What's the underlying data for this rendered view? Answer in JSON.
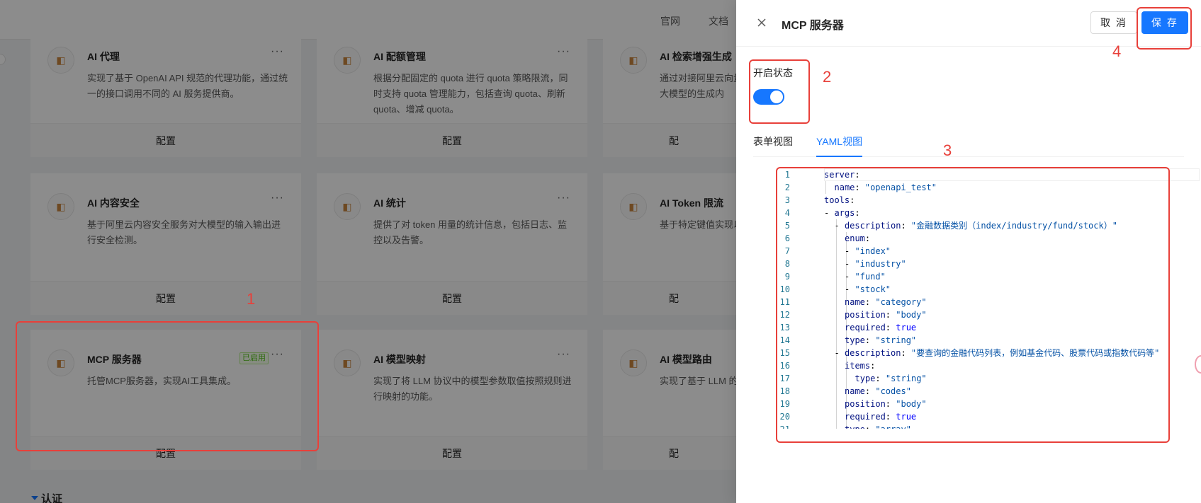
{
  "topbar": {
    "links": [
      "官网",
      "文档"
    ]
  },
  "cards": [
    {
      "title": "AI 代理",
      "desc": "实现了基于 OpenAI API 规范的代理功能，通过统一的接口调用不同的 AI 服务提供商。",
      "config": "配置",
      "more": "···"
    },
    {
      "title": "AI 配额管理",
      "desc": "根据分配固定的 quota 进行 quota 策略限流，同时支持 quota 管理能力，包括查询 quota、刷新 quota、增减 quota。",
      "config": "配置",
      "more": "···"
    },
    {
      "title": "AI 检索增强生成",
      "desc": "通过对接阿里云向量检索服务（DashVector）化大模型的生成内",
      "config": "配",
      "more": ""
    },
    {
      "title": "AI 内容安全",
      "desc": "基于阿里云内容安全服务对大模型的输入输出进行安全检测。",
      "config": "配置",
      "more": "···"
    },
    {
      "title": "AI 统计",
      "desc": "提供了对 token 用量的统计信息，包括日志、监控以及告警。",
      "config": "配置",
      "more": "···"
    },
    {
      "title": "AI Token 限流",
      "desc": "基于特定键值实现以是 URL 参数、H址等。",
      "config": "配",
      "more": ""
    },
    {
      "title": "MCP 服务器",
      "desc": "托管MCP服务器，实现AI工具集成。",
      "config": "配置",
      "more": "···",
      "badge": "已启用"
    },
    {
      "title": "AI 模型映射",
      "desc": "实现了将 LLM 协议中的模型参数取值按照规则进行映射的功能。",
      "config": "配置",
      "more": "···"
    },
    {
      "title": "AI 模型路由",
      "desc": "实现了基于 LLM 的功能",
      "config": "配",
      "more": ""
    }
  ],
  "section": {
    "title": "认证"
  },
  "drawer": {
    "title": "MCP 服务器",
    "cancel_label": "取 消",
    "save_label": "保 存",
    "status_label": "开启状态",
    "status_enabled": true,
    "tabs": [
      {
        "label": "表单视图",
        "active": false
      },
      {
        "label": "YAML视图",
        "active": true
      }
    ]
  },
  "yaml_lines": [
    {
      "n": "1",
      "indent": 0,
      "parts": [
        [
          "k",
          "server"
        ],
        [
          "p",
          ":"
        ]
      ]
    },
    {
      "n": "2",
      "indent": 1,
      "parts": [
        [
          "k",
          "name"
        ],
        [
          "p",
          ": "
        ],
        [
          "s",
          "\"openapi_test\""
        ]
      ]
    },
    {
      "n": "3",
      "indent": 0,
      "parts": [
        [
          "k",
          "tools"
        ],
        [
          "p",
          ":"
        ]
      ]
    },
    {
      "n": "4",
      "indent": 0,
      "parts": [
        [
          "p",
          "- "
        ],
        [
          "k",
          "args"
        ],
        [
          "p",
          ":"
        ]
      ]
    },
    {
      "n": "5",
      "indent": 1,
      "parts": [
        [
          "p",
          "- "
        ],
        [
          "k",
          "description"
        ],
        [
          "p",
          ": "
        ],
        [
          "s",
          "\"金融数据类别（index/industry/fund/stock）\""
        ]
      ]
    },
    {
      "n": "6",
      "indent": 2,
      "parts": [
        [
          "k",
          "enum"
        ],
        [
          "p",
          ":"
        ]
      ]
    },
    {
      "n": "7",
      "indent": 2,
      "parts": [
        [
          "p",
          "- "
        ],
        [
          "s",
          "\"index\""
        ]
      ]
    },
    {
      "n": "8",
      "indent": 2,
      "parts": [
        [
          "p",
          "- "
        ],
        [
          "s",
          "\"industry\""
        ]
      ]
    },
    {
      "n": "9",
      "indent": 2,
      "parts": [
        [
          "p",
          "- "
        ],
        [
          "s",
          "\"fund\""
        ]
      ]
    },
    {
      "n": "10",
      "indent": 2,
      "parts": [
        [
          "p",
          "- "
        ],
        [
          "s",
          "\"stock\""
        ]
      ]
    },
    {
      "n": "11",
      "indent": 2,
      "parts": [
        [
          "k",
          "name"
        ],
        [
          "p",
          ": "
        ],
        [
          "s",
          "\"category\""
        ]
      ]
    },
    {
      "n": "12",
      "indent": 2,
      "parts": [
        [
          "k",
          "position"
        ],
        [
          "p",
          ": "
        ],
        [
          "s",
          "\"body\""
        ]
      ]
    },
    {
      "n": "13",
      "indent": 2,
      "parts": [
        [
          "k",
          "required"
        ],
        [
          "p",
          ": "
        ],
        [
          "b",
          "true"
        ]
      ]
    },
    {
      "n": "14",
      "indent": 2,
      "parts": [
        [
          "k",
          "type"
        ],
        [
          "p",
          ": "
        ],
        [
          "s",
          "\"string\""
        ]
      ]
    },
    {
      "n": "15",
      "indent": 1,
      "parts": [
        [
          "p",
          "- "
        ],
        [
          "k",
          "description"
        ],
        [
          "p",
          ": "
        ],
        [
          "s",
          "\"要查询的金融代码列表，例如基金代码、股票代码或指数代码等\""
        ]
      ]
    },
    {
      "n": "16",
      "indent": 2,
      "parts": [
        [
          "k",
          "items"
        ],
        [
          "p",
          ":"
        ]
      ]
    },
    {
      "n": "17",
      "indent": 3,
      "parts": [
        [
          "k",
          "type"
        ],
        [
          "p",
          ": "
        ],
        [
          "s",
          "\"string\""
        ]
      ]
    },
    {
      "n": "18",
      "indent": 2,
      "parts": [
        [
          "k",
          "name"
        ],
        [
          "p",
          ": "
        ],
        [
          "s",
          "\"codes\""
        ]
      ]
    },
    {
      "n": "19",
      "indent": 2,
      "parts": [
        [
          "k",
          "position"
        ],
        [
          "p",
          ": "
        ],
        [
          "s",
          "\"body\""
        ]
      ]
    },
    {
      "n": "20",
      "indent": 2,
      "parts": [
        [
          "k",
          "required"
        ],
        [
          "p",
          ": "
        ],
        [
          "b",
          "true"
        ]
      ]
    },
    {
      "n": "21",
      "indent": 2,
      "parts": [
        [
          "k",
          "type"
        ],
        [
          "p",
          ": "
        ],
        [
          "s",
          "\"array\""
        ]
      ]
    }
  ],
  "annotations": [
    "1",
    "2",
    "3",
    "4"
  ],
  "colors": {
    "primary": "#1677ff",
    "annotation": "#e8403a",
    "badge": "#52c41a"
  }
}
